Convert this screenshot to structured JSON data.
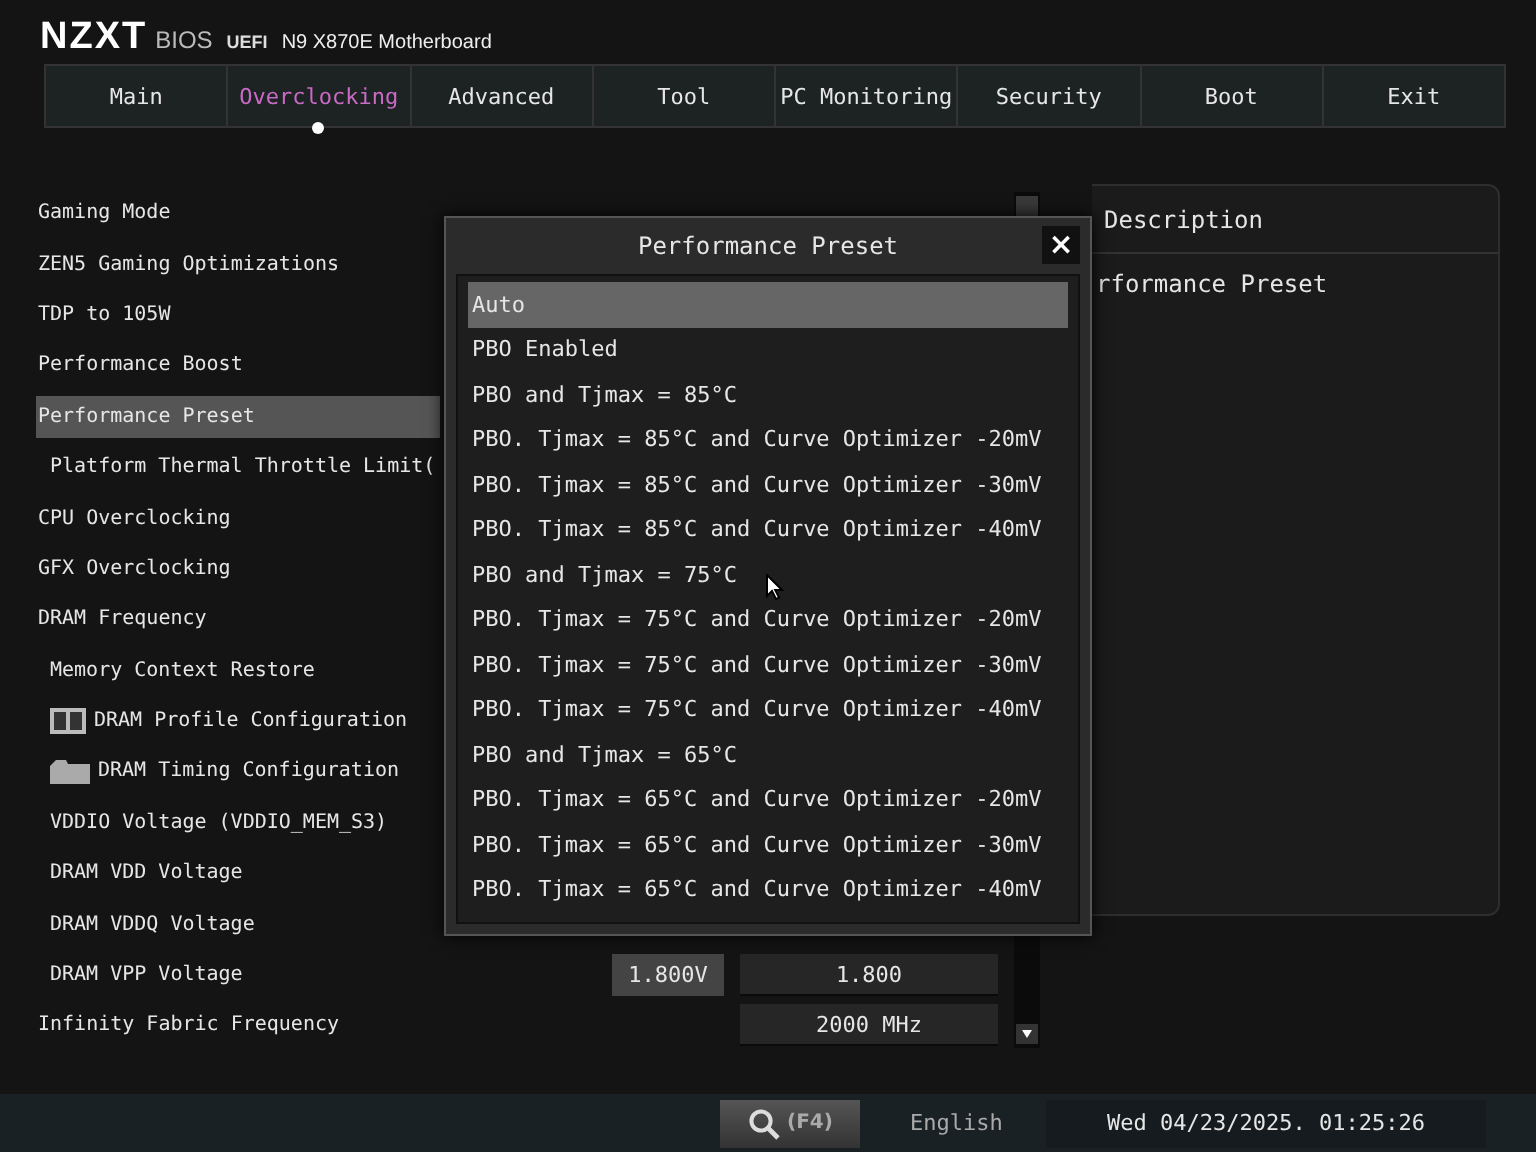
{
  "header": {
    "brand": "NZXT",
    "product": "BIOS",
    "firmware": "UEFI",
    "model": "N9 X870E Motherboard"
  },
  "tabs": [
    {
      "label": "Main",
      "selected": false
    },
    {
      "label": "Overclocking",
      "selected": true
    },
    {
      "label": "Advanced",
      "selected": false
    },
    {
      "label": "Tool",
      "selected": false
    },
    {
      "label": "PC Monitoring",
      "selected": false
    },
    {
      "label": "Security",
      "selected": false
    },
    {
      "label": "Boot",
      "selected": false
    },
    {
      "label": "Exit",
      "selected": false
    }
  ],
  "settings": [
    {
      "label": "Gaming Mode",
      "kind": "setting",
      "selected": false
    },
    {
      "label": "ZEN5 Gaming Optimizations",
      "kind": "setting",
      "selected": false
    },
    {
      "label": "TDP to 105W",
      "kind": "setting",
      "selected": false
    },
    {
      "label": "Performance Boost",
      "kind": "setting",
      "selected": false
    },
    {
      "label": "Performance Preset",
      "kind": "setting",
      "selected": true
    },
    {
      "label": "Platform Thermal Throttle Limit(",
      "kind": "sub",
      "selected": false
    },
    {
      "label": "CPU Overclocking",
      "kind": "setting",
      "selected": false
    },
    {
      "label": "GFX Overclocking",
      "kind": "setting",
      "selected": false
    },
    {
      "label": "DRAM Frequency",
      "kind": "setting",
      "selected": false
    },
    {
      "label": "Memory Context Restore",
      "kind": "sub",
      "selected": false
    },
    {
      "label": "DRAM Profile Configuration",
      "kind": "profile",
      "selected": false
    },
    {
      "label": "DRAM Timing Configuration",
      "kind": "folder",
      "selected": false
    },
    {
      "label": "VDDIO Voltage (VDDIO_MEM_S3)",
      "kind": "sub",
      "selected": false
    },
    {
      "label": "DRAM VDD Voltage",
      "kind": "sub",
      "selected": false
    },
    {
      "label": "DRAM VDDQ Voltage",
      "kind": "sub",
      "selected": false
    },
    {
      "label": "DRAM VPP Voltage",
      "kind": "sub",
      "selected": false,
      "current": "1.800V",
      "value": "1.800"
    },
    {
      "label": "Infinity Fabric Frequency",
      "kind": "setting",
      "selected": false,
      "value": "2000 MHz"
    }
  ],
  "description": {
    "title": "Description",
    "text": "rformance Preset"
  },
  "dialog": {
    "title": "Performance Preset",
    "close": "×",
    "options": [
      {
        "label": "Auto",
        "selected": true
      },
      {
        "label": "PBO Enabled",
        "selected": false
      },
      {
        "label": "PBO and Tjmax = 85°C",
        "selected": false
      },
      {
        "label": "PBO. Tjmax = 85°C and Curve Optimizer -20mV",
        "selected": false
      },
      {
        "label": "PBO. Tjmax = 85°C and Curve Optimizer -30mV",
        "selected": false
      },
      {
        "label": "PBO. Tjmax = 85°C and Curve Optimizer -40mV",
        "selected": false
      },
      {
        "label": "PBO and Tjmax = 75°C",
        "selected": false
      },
      {
        "label": "PBO. Tjmax = 75°C and Curve Optimizer -20mV",
        "selected": false
      },
      {
        "label": "PBO. Tjmax = 75°C and Curve Optimizer -30mV",
        "selected": false
      },
      {
        "label": "PBO. Tjmax = 75°C and Curve Optimizer -40mV",
        "selected": false
      },
      {
        "label": "PBO and Tjmax = 65°C",
        "selected": false
      },
      {
        "label": "PBO. Tjmax = 65°C and Curve Optimizer -20mV",
        "selected": false
      },
      {
        "label": "PBO. Tjmax = 65°C and Curve Optimizer -30mV",
        "selected": false
      },
      {
        "label": "PBO. Tjmax = 65°C and Curve Optimizer -40mV",
        "selected": false
      }
    ]
  },
  "status_bar": {
    "search_key": "(F4)",
    "language": "English",
    "datetime": "Wed 04/23/2025. 01:25:26"
  }
}
